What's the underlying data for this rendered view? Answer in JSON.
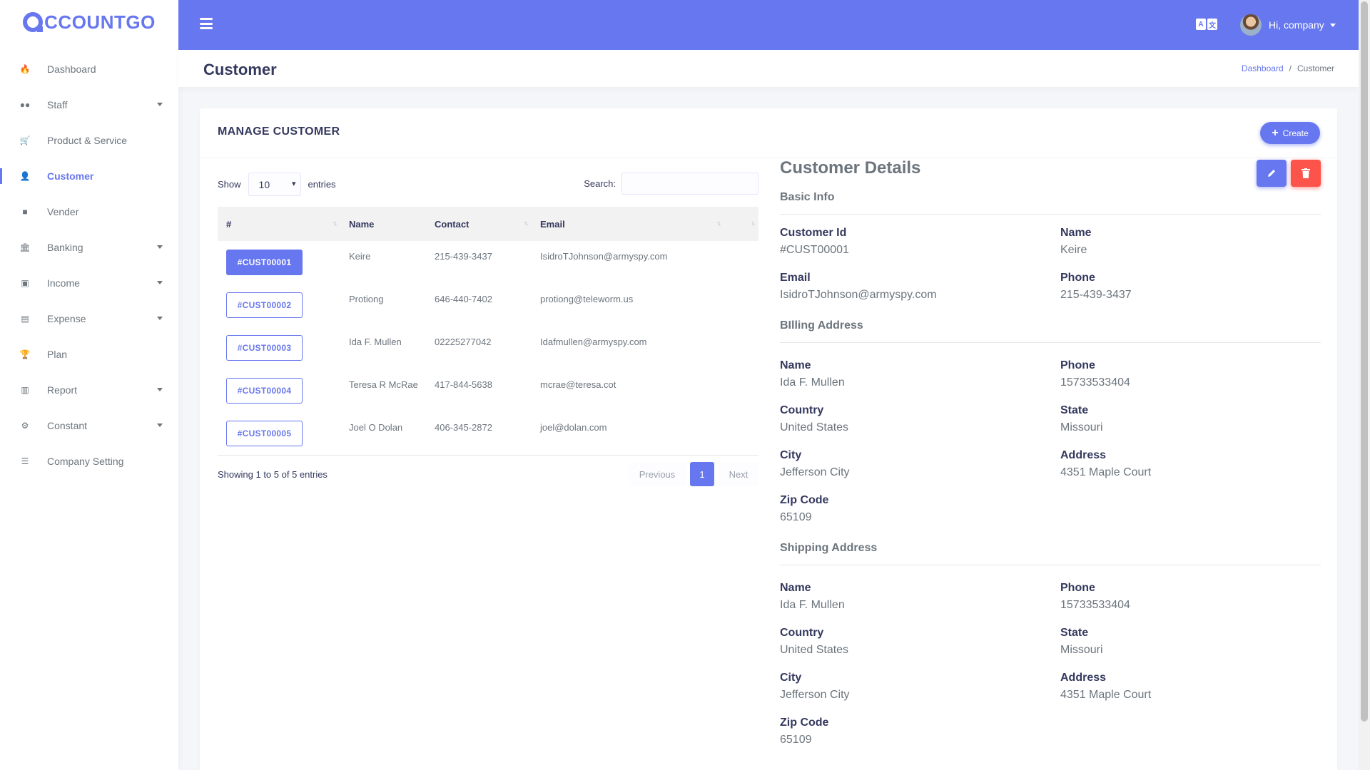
{
  "app": {
    "logo_text": "CCOUNTGO"
  },
  "sidebar": {
    "items": [
      {
        "label": "Dashboard",
        "icon": "fire-icon"
      },
      {
        "label": "Staff",
        "icon": "users-icon",
        "has_submenu": true
      },
      {
        "label": "Product & Service",
        "icon": "cart-icon"
      },
      {
        "label": "Customer",
        "icon": "user-icon",
        "active": true
      },
      {
        "label": "Vender",
        "icon": "note-icon"
      },
      {
        "label": "Banking",
        "icon": "bank-icon",
        "has_submenu": true
      },
      {
        "label": "Income",
        "icon": "money-icon",
        "has_submenu": true
      },
      {
        "label": "Expense",
        "icon": "money-bill-icon",
        "has_submenu": true
      },
      {
        "label": "Plan",
        "icon": "trophy-icon"
      },
      {
        "label": "Report",
        "icon": "chart-icon",
        "has_submenu": true
      },
      {
        "label": "Constant",
        "icon": "gear-icon",
        "has_submenu": true
      },
      {
        "label": "Company Setting",
        "icon": "sliders-icon"
      }
    ]
  },
  "navbar": {
    "user_greeting": "Hi, company",
    "lang_icon": "translate-icon"
  },
  "header": {
    "title": "Customer",
    "breadcrumb": {
      "home": "Dashboard",
      "separator": "/",
      "current": "Customer"
    }
  },
  "card": {
    "title": "MANAGE CUSTOMER",
    "create_label": "Create"
  },
  "table": {
    "show_label": "Show",
    "page_size": "10",
    "entries_label": "entries",
    "search_label": "Search:",
    "columns": [
      "#",
      "Name",
      "Contact",
      "Email"
    ],
    "rows": [
      {
        "id": "#CUST00001",
        "name": "Keire",
        "contact": "215-439-3437",
        "email": "IsidroTJohnson@armyspy.com",
        "selected": true
      },
      {
        "id": "#CUST00002",
        "name": "Protiong",
        "contact": "646-440-7402",
        "email": "protiong@teleworm.us"
      },
      {
        "id": "#CUST00003",
        "name": "Ida F. Mullen",
        "contact": "02225277042",
        "email": "Idafmullen@armyspy.com"
      },
      {
        "id": "#CUST00004",
        "name": "Teresa R McRae",
        "contact": "417-844-5638",
        "email": "mcrae@teresa.cot"
      },
      {
        "id": "#CUST00005",
        "name": "Joel O Dolan",
        "contact": "406-345-2872",
        "email": "joel@dolan.com"
      }
    ],
    "info": "Showing 1 to 5 of 5 entries",
    "pagination": {
      "previous": "Previous",
      "page": "1",
      "next": "Next"
    }
  },
  "details": {
    "title": "Customer Details",
    "basic": {
      "heading": "Basic Info",
      "customer_id_label": "Customer Id",
      "customer_id": "#CUST00001",
      "name_label": "Name",
      "name": "Keire",
      "email_label": "Email",
      "email": "IsidroTJohnson@armyspy.com",
      "phone_label": "Phone",
      "phone": "215-439-3437"
    },
    "billing": {
      "heading": "BIlling Address",
      "name_label": "Name",
      "name": "Ida F. Mullen",
      "phone_label": "Phone",
      "phone": "15733533404",
      "country_label": "Country",
      "country": "United States",
      "state_label": "State",
      "state": "Missouri",
      "city_label": "City",
      "city": "Jefferson City",
      "address_label": "Address",
      "address": "4351 Maple Court",
      "zip_label": "Zip Code",
      "zip": "65109"
    },
    "shipping": {
      "heading": "Shipping Address",
      "name_label": "Name",
      "name": "Ida F. Mullen",
      "phone_label": "Phone",
      "phone": "15733533404",
      "country_label": "Country",
      "country": "United States",
      "state_label": "State",
      "state": "Missouri",
      "city_label": "City",
      "city": "Jefferson City",
      "address_label": "Address",
      "address": "4351 Maple Court",
      "zip_label": "Zip Code",
      "zip": "65109"
    }
  },
  "colors": {
    "primary": "#6777ef",
    "danger": "#fc544b",
    "text": "#34395e",
    "muted": "#6c757d"
  }
}
